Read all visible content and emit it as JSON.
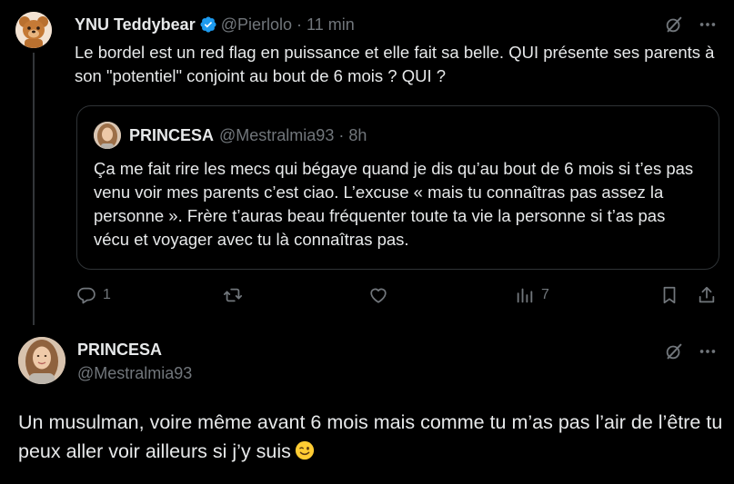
{
  "tweet": {
    "author": "YNU Teddybear",
    "handle": "@Pierlolo",
    "separator": "·",
    "time": "11 min",
    "text": "Le bordel est un red flag en puissance et elle fait sa belle. QUI présente ses parents à son \"potentiel\" conjoint au bout de 6 mois ? QUI ?",
    "quote": {
      "author": "PRINCESA",
      "handle": "@Mestralmia93",
      "separator": "·",
      "time": "8h",
      "text": "Ça me fait rire les mecs qui bégaye quand je dis qu’au bout de 6 mois si t’es pas venu voir mes parents c’est ciao. L’excuse « mais tu connaîtras pas assez la personne ». Frère t’auras beau fréquenter toute ta vie la personne si t’as pas vécu et voyager avec tu là connaîtras pas."
    },
    "actions": {
      "replies": "1",
      "views": "7"
    }
  },
  "reply": {
    "author": "PRINCESA",
    "handle": "@Mestralmia93",
    "text": "Un musulman, voire même avant 6 mois mais comme tu m’as pas l’air de l’être tu peux aller voir ailleurs si j’y suis",
    "emoji": "winking-face-emoji"
  },
  "colors": {
    "background": "#000000",
    "text": "#e7e9ea",
    "muted": "#71767b",
    "border": "#2f3336",
    "verified": "#1d9bf0"
  },
  "icons": [
    "verified-badge-icon",
    "grok-icon",
    "more-icon",
    "reply-icon",
    "retweet-icon",
    "like-icon",
    "views-icon",
    "bookmark-icon",
    "share-icon"
  ]
}
